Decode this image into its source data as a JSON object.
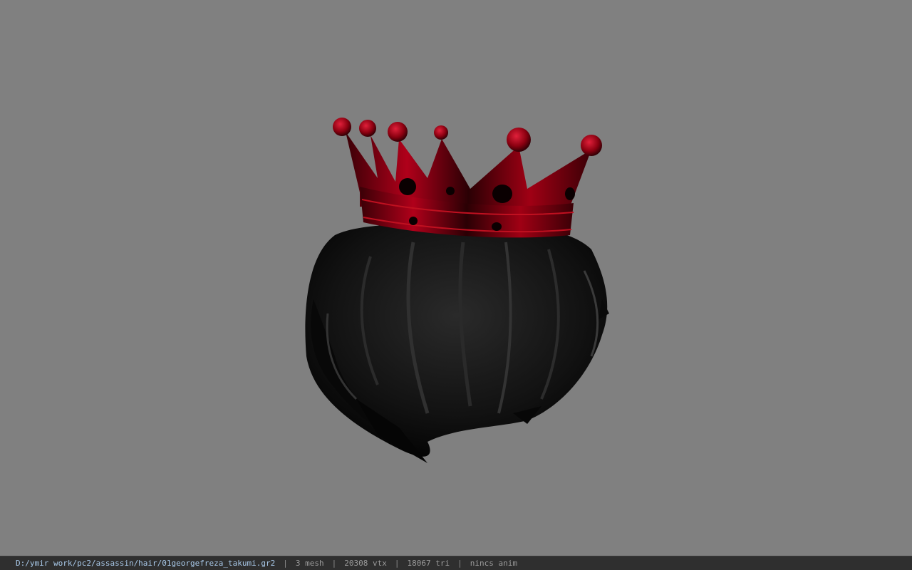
{
  "viewport": {
    "background": "#808080",
    "model_description_icon": "hair-crown-model"
  },
  "colors": {
    "crown_red": "#a00010",
    "crown_dark": "#1a0002",
    "hair_dark": "#0c0c0c",
    "status_path": "#a8c8e8"
  },
  "statusbar": {
    "file_path": "D:/ymir work/pc2/assassin/hair/01georgefreza_takumi.gr2",
    "separator": "|",
    "mesh_count": "3 mesh",
    "vertex_count": "20308 vtx",
    "triangle_count": "18067 tri",
    "anim_status": "nincs anim"
  }
}
